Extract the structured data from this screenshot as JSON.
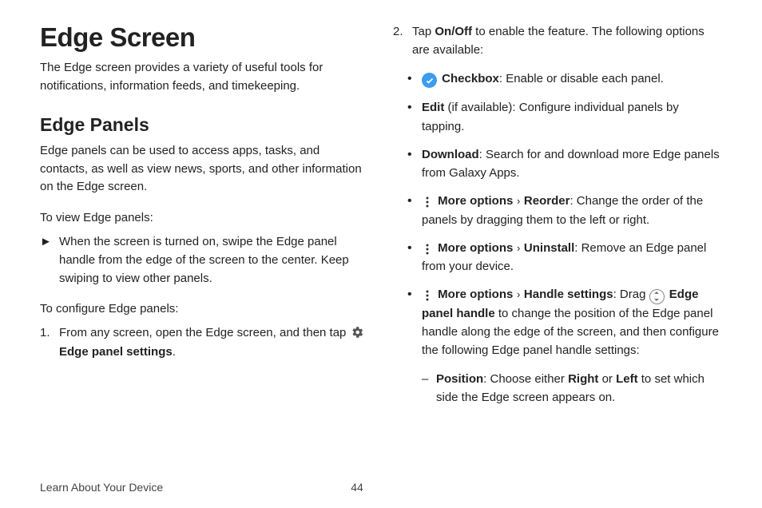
{
  "title": "Edge Screen",
  "intro": "The Edge screen provides a variety of useful tools for notifications, information feeds, and timekeeping.",
  "section_heading": "Edge Panels",
  "section_intro": "Edge panels can be used to access apps, tasks, and contacts, as well as view news, sports, and other information on the Edge screen.",
  "view_heading": "To view Edge panels:",
  "view_step": "When the screen is turned on, swipe the Edge panel handle from the edge of the screen to the center. Keep swiping to view other panels.",
  "config_heading": "To configure Edge panels:",
  "config_step1_pre": "From any screen, open the Edge screen, and then tap ",
  "config_step1_label": "Edge panel settings",
  "config_step1_post": ".",
  "config_step2_pre": "Tap ",
  "config_step2_bold": "On/Off",
  "config_step2_post": " to enable the feature. The following options are available:",
  "opt_checkbox_label": "Checkbox",
  "opt_checkbox_post": ": Enable or disable each panel.",
  "opt_edit_label": "Edit",
  "opt_edit_post": " (if available): Configure individual panels by tapping.",
  "opt_download_label": "Download",
  "opt_download_post": ": Search for and download more Edge panels from Galaxy Apps.",
  "opt_more": "More options",
  "opt_reorder_label": "Reorder",
  "opt_reorder_post": ": Change the order of the panels by dragging them to the left or right.",
  "opt_uninstall_label": "Uninstall",
  "opt_uninstall_post": ": Remove an Edge panel from your device.",
  "opt_handle_label": "Handle settings",
  "opt_handle_mid": ": Drag ",
  "opt_handle_icon_label": "Edge panel handle",
  "opt_handle_post": " to change the position of the Edge panel handle along the edge of the screen, and then configure the following Edge panel handle settings:",
  "pos_label": "Position",
  "pos_mid1": ": Choose either ",
  "pos_right": "Right",
  "pos_mid2": " or ",
  "pos_left": "Left",
  "pos_post": " to set which side the Edge screen appears on.",
  "footer_left": "Learn About Your Device",
  "footer_page": "44"
}
